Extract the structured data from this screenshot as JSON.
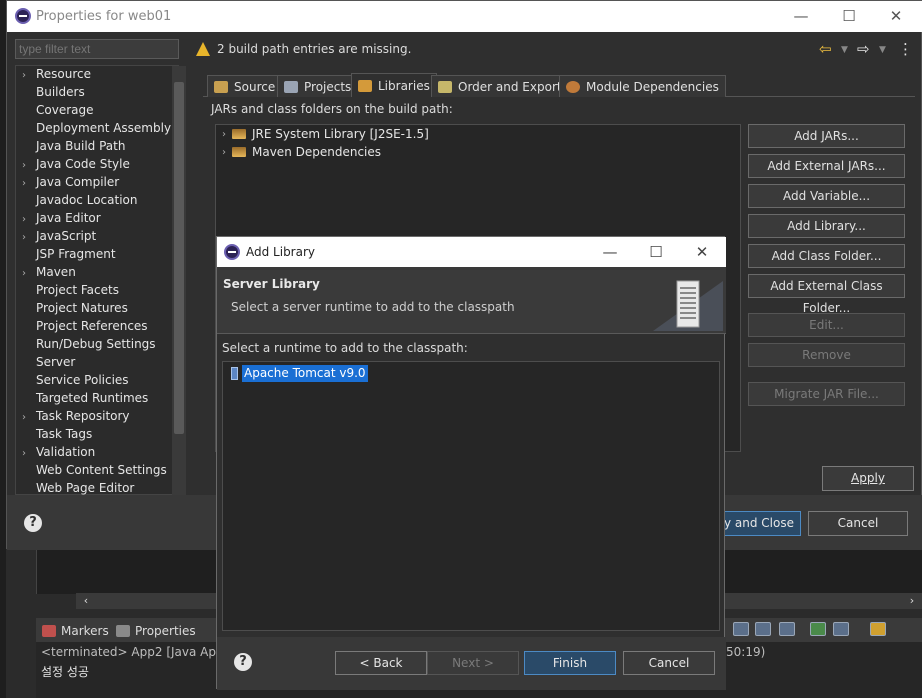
{
  "ide": {
    "views": [
      {
        "label": "Markers",
        "icon": "markers-icon"
      },
      {
        "label": "Properties",
        "icon": "properties-icon"
      }
    ],
    "console_line1": "<terminated> App2 [Java Applic",
    "console_line1_tail": "50:19)",
    "console_line2": "설정 성공"
  },
  "properties": {
    "title": "Properties for web01",
    "filter_placeholder": "type filter text",
    "tree": [
      {
        "label": "Resource",
        "expandable": true
      },
      {
        "label": "Builders",
        "expandable": false
      },
      {
        "label": "Coverage",
        "expandable": false
      },
      {
        "label": "Deployment Assembly",
        "expandable": false
      },
      {
        "label": "Java Build Path",
        "expandable": false
      },
      {
        "label": "Java Code Style",
        "expandable": true
      },
      {
        "label": "Java Compiler",
        "expandable": true
      },
      {
        "label": "Javadoc Location",
        "expandable": false
      },
      {
        "label": "Java Editor",
        "expandable": true
      },
      {
        "label": "JavaScript",
        "expandable": true
      },
      {
        "label": "JSP Fragment",
        "expandable": false
      },
      {
        "label": "Maven",
        "expandable": true
      },
      {
        "label": "Project Facets",
        "expandable": false
      },
      {
        "label": "Project Natures",
        "expandable": false
      },
      {
        "label": "Project References",
        "expandable": false
      },
      {
        "label": "Run/Debug Settings",
        "expandable": false
      },
      {
        "label": "Server",
        "expandable": false
      },
      {
        "label": "Service Policies",
        "expandable": false
      },
      {
        "label": "Targeted Runtimes",
        "expandable": false
      },
      {
        "label": "Task Repository",
        "expandable": true
      },
      {
        "label": "Task Tags",
        "expandable": false
      },
      {
        "label": "Validation",
        "expandable": true
      },
      {
        "label": "Web Content Settings",
        "expandable": false
      },
      {
        "label": "Web Page Editor",
        "expandable": false
      }
    ],
    "warning": "2 build path entries are missing.",
    "tabs": [
      {
        "label": "Source"
      },
      {
        "label": "Projects"
      },
      {
        "label": "Libraries"
      },
      {
        "label": "Order and Export"
      },
      {
        "label": "Module Dependencies"
      }
    ],
    "build_path_label": "JARs and class folders on the build path:",
    "libraries": [
      {
        "label": "JRE System Library [J2SE-1.5]"
      },
      {
        "label": "Maven Dependencies"
      }
    ],
    "side_buttons": [
      {
        "label": "Add JARs...",
        "enabled": true
      },
      {
        "label": "Add External JARs...",
        "enabled": true
      },
      {
        "label": "Add Variable...",
        "enabled": true
      },
      {
        "label": "Add Library...",
        "enabled": true
      },
      {
        "label": "Add Class Folder...",
        "enabled": true
      },
      {
        "label": "Add External Class Folder...",
        "enabled": true
      },
      {
        "label": "Edit...",
        "enabled": false
      },
      {
        "label": "Remove",
        "enabled": false
      },
      {
        "label": "Migrate JAR File...",
        "enabled": false
      }
    ],
    "apply": "Apply",
    "apply_close": "ply and Close",
    "cancel": "Cancel"
  },
  "dialog": {
    "title": "Add Library",
    "header_title": "Server Library",
    "header_desc": "Select a server runtime to add to the classpath",
    "runtime_label": "Select a runtime to add to the classpath:",
    "runtimes": [
      {
        "label": "Apache Tomcat v9.0",
        "selected": true
      }
    ],
    "back": "< Back",
    "next": "Next >",
    "finish": "Finish",
    "cancel": "Cancel"
  }
}
